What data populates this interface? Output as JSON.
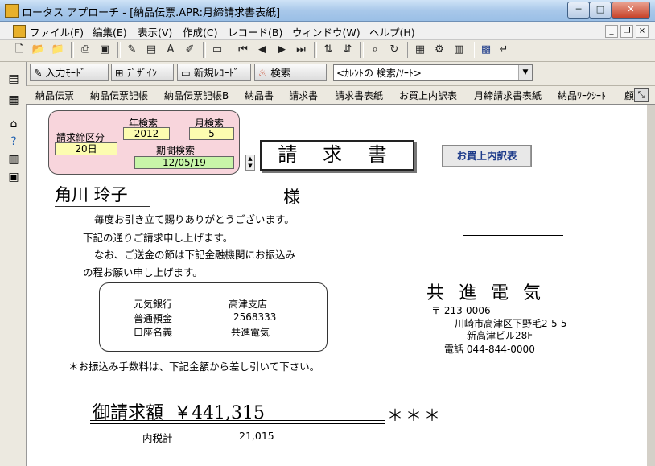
{
  "window": {
    "title": "ロータス アプローチ - [納品伝票.APR:月締請求書表紙]",
    "min": "─",
    "max": "□",
    "close": "✕",
    "mdi_min": "_",
    "mdi_restore": "❐",
    "mdi_close": "×"
  },
  "menu": [
    "ファイル(F)",
    "編集(E)",
    "表示(V)",
    "作成(C)",
    "レコード(B)",
    "ウィンドウ(W)",
    "ヘルプ(H)"
  ],
  "toolbar2": {
    "input_mode": "入力ﾓｰﾄﾞ",
    "design": "ﾃﾞｻﾞｲﾝ",
    "new_record": "新規ﾚｺｰﾄﾞ",
    "search": "検索",
    "search_combo": "<ｶﾚﾝﾄの 検索/ｿｰﾄ>",
    "combo_arrow": "▼"
  },
  "tabs": [
    "納品伝票",
    "納品伝票記帳",
    "納品伝票記帳B",
    "納品書",
    "請求書",
    "請求書表紙",
    "お買上内訳表",
    "月締請求書表紙",
    "納品ﾜｰｸｼｰﾄ",
    "顧"
  ],
  "panel": {
    "label_kubun": "請求締区分",
    "kubun_value": "20日",
    "label_year": "年検索",
    "year_value": "2012",
    "label_month": "月検索",
    "month_value": "5",
    "label_period": "期間検索",
    "period_value": "12/05/19"
  },
  "doc": {
    "title": "請 求 書",
    "button_uchiwake": "お買上内訳表",
    "customer": "角川 玲子",
    "sama": "様",
    "greeting": [
      "毎度お引き立て賜りありがとうございます。",
      "下記の通りご請求申し上げます。",
      "なお、ご送金の節は下記金融機関にお振込み",
      "の程お願い申し上げます。"
    ],
    "bank": {
      "bank_name": "元気銀行",
      "branch": "高津支店",
      "account_type": "普通預金",
      "account_no": "2568333",
      "holder_label": "口座名義",
      "holder": "共進電気"
    },
    "fee_note": "＊お振込み手数料は、下記金額から差し引いて下さい。",
    "company": {
      "name": "共進電気",
      "postal": "〒 213-0006",
      "address1": "川崎市高津区下野毛2-5-5",
      "address2": "新高津ビル28F",
      "phone": "電話 044-844-0000"
    },
    "amount_label": "御請求額",
    "amount_value": "￥441,315",
    "stars": "＊＊＊",
    "tax_label": "内税計",
    "tax_value": "21,015"
  }
}
